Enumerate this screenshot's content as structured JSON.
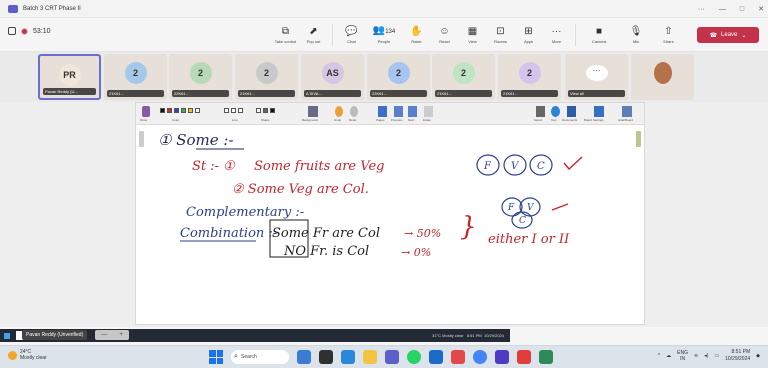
{
  "window": {
    "title": "Batch 3 CRT Phase II",
    "controls": [
      "···",
      "—",
      "□",
      "✕"
    ]
  },
  "toolbar": {
    "timer": "53:10",
    "tools": [
      {
        "label": "Take control",
        "icon": "⧉"
      },
      {
        "label": "Pop out",
        "icon": "⬈"
      },
      {
        "label": "Chat",
        "icon": "💬"
      },
      {
        "label": "People",
        "icon": "👥",
        "count": "134"
      },
      {
        "label": "Raise",
        "icon": "✋"
      },
      {
        "label": "React",
        "icon": "☺"
      },
      {
        "label": "View",
        "icon": "▦"
      },
      {
        "label": "Rooms",
        "icon": "⊡"
      },
      {
        "label": "Apps",
        "icon": "⊞"
      },
      {
        "label": "More",
        "icon": "···"
      },
      {
        "label": "Camera",
        "icon": "■"
      },
      {
        "label": "Mic",
        "icon": "🎙"
      },
      {
        "label": "Share",
        "icon": "⇧"
      }
    ],
    "leave_label": "Leave"
  },
  "participants": [
    {
      "initials": "PR",
      "name": "Pavan Reddy (U...",
      "color": "#f0e6da",
      "selected": true
    },
    {
      "initials": "2",
      "name": "21K61... ",
      "color": "#a4c8ea"
    },
    {
      "initials": "2",
      "name": "22K61... ",
      "color": "#b7d9b5"
    },
    {
      "initials": "2",
      "name": "21K61... ",
      "color": "#c9c9c9"
    },
    {
      "initials": "AS",
      "name": "A SIVA...",
      "color": "#d6c6e6"
    },
    {
      "initials": "2",
      "name": "22K61... ",
      "color": "#a8c4f0"
    },
    {
      "initials": "2",
      "name": "21K61... ",
      "color": "#bfe3c5"
    },
    {
      "initials": "2",
      "name": "21K61... ",
      "color": "#d4c4ec"
    },
    {
      "initials": "···",
      "name": "View all",
      "color": "#ffffff"
    },
    {
      "initials": "",
      "name": "",
      "color": "#e3d6c4"
    }
  ],
  "board": {
    "toolbar_labels": [
      "Draw",
      "Color",
      "Line",
      "Shape",
      "Background",
      "Undo",
      "Redo",
      "Pages",
      "Previous",
      "Next",
      "Erase",
      "Select",
      "Text",
      "Documents",
      "Board Settings",
      "Hide/Board"
    ],
    "notes": {
      "n1": "① Some :-",
      "st": "St :- ①",
      "l1": "Some fruits are Veg",
      "l2": "② Some Veg are Col.",
      "comp": "Complementary :-",
      "comb": "Combination :-",
      "r1": "Some Fr are Col",
      "r1p": "→ 50%",
      "r2": "NO Fr. is Col",
      "r2p": "→ 0%",
      "either": "either I or II",
      "venn1": [
        "F",
        "V",
        "C"
      ],
      "venn2": [
        "F",
        "V",
        "C"
      ]
    }
  },
  "self_view": {
    "name": "Pavan Reddy (Unverified)"
  },
  "inner_taskbar": {
    "search": "Type here to search",
    "tray": "31°C  Mostly clear",
    "time": "8:51 PM",
    "date": "10/29/2024"
  },
  "taskbar": {
    "weather_temp": "24°C",
    "weather_desc": "Mostly clear",
    "search": "Search",
    "lang": "ENG",
    "lang2": "IN",
    "time": "8:51 PM",
    "date": "10/29/2024"
  },
  "colors": {
    "accent": "#5b5fc7",
    "leave": "#c4314b",
    "ink_red": "#c5242b",
    "ink_blue": "#2c3f8f"
  }
}
